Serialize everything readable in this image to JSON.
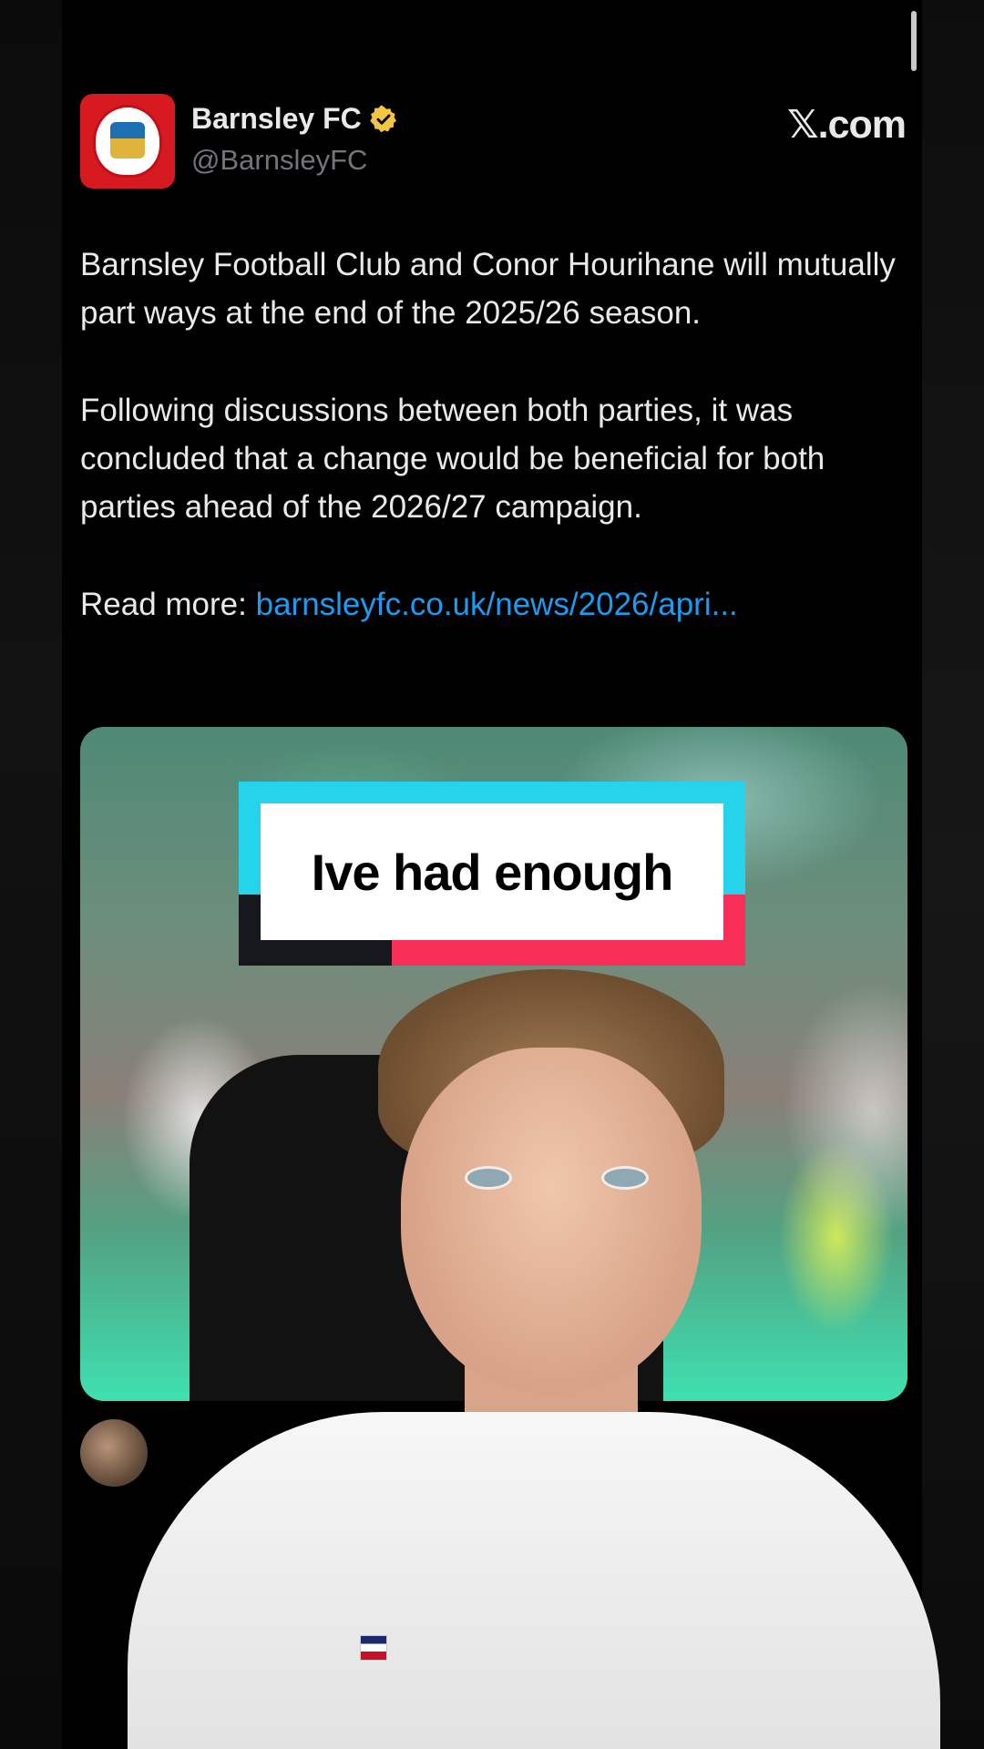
{
  "tweet": {
    "display_name": "Barnsley FC",
    "handle": "@BarnsleyFC",
    "site_label": "X.com",
    "site_glyph": "𝕏",
    "site_suffix": ".com",
    "paragraph_1": "Barnsley Football Club and Conor Hourihane will mutually part ways at the end of the 2025/26 season.",
    "paragraph_2": "Following discussions between both parties, it was concluded that a change would be beneficial for both parties ahead of the 2026/27 campaign.",
    "read_more_label": "Read more:",
    "read_more_link": "barnsleyfc.co.uk/news/2026/apri...",
    "verified_color": "#f4c542",
    "link_color": "#1d9bf0"
  },
  "caption": {
    "text": "Ive had enough",
    "colors": {
      "cyan": "#25d4ea",
      "pink": "#f72e57",
      "dark": "#16181d"
    }
  },
  "icons": [
    "club-crest-icon",
    "verified-badge-icon",
    "x-logo-icon"
  ]
}
